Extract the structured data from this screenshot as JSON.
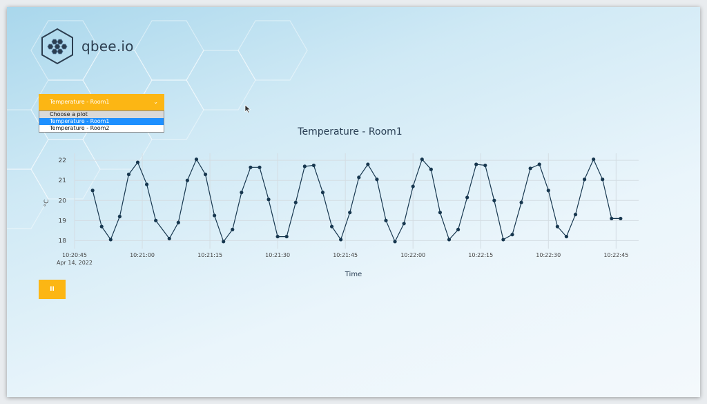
{
  "logo": {
    "text": "qbee.io"
  },
  "plot_select": {
    "selected": "Temperature - Room1",
    "chevron_icon": "chevron-down-icon",
    "options": [
      "Choose a plot",
      "Temperature - Room1",
      "Temperature - Room2"
    ]
  },
  "pause_button": {
    "label": "II",
    "icon": "pause-icon"
  },
  "colors": {
    "accent": "#fcb614",
    "line": "#17374f",
    "selected_option": "#1e90ff"
  },
  "chart_data": {
    "type": "line",
    "title": "Temperature - Room1",
    "xlabel": "Time",
    "ylabel": "°C",
    "ylim": [
      17.6,
      22.35
    ],
    "yticks": [
      18,
      19,
      20,
      21,
      22
    ],
    "xlim_seconds_after_10_20_45": [
      0,
      125
    ],
    "xticks": [
      {
        "label": "10:20:45",
        "sublabel": "Apr 14, 2022",
        "t": 0
      },
      {
        "label": "10:21:00",
        "sublabel": "",
        "t": 15
      },
      {
        "label": "10:21:15",
        "sublabel": "",
        "t": 30
      },
      {
        "label": "10:21:30",
        "sublabel": "",
        "t": 45
      },
      {
        "label": "10:21:45",
        "sublabel": "",
        "t": 60
      },
      {
        "label": "10:22:00",
        "sublabel": "",
        "t": 75
      },
      {
        "label": "10:22:15",
        "sublabel": "",
        "t": 90
      },
      {
        "label": "10:22:30",
        "sublabel": "",
        "t": 105
      },
      {
        "label": "10:22:45",
        "sublabel": "",
        "t": 120
      }
    ],
    "grid": true,
    "series": [
      {
        "name": "",
        "t": [
          4,
          6,
          8,
          10,
          12,
          14,
          16,
          18,
          21,
          23,
          25,
          27,
          29,
          31,
          33,
          35,
          37,
          39,
          41,
          43,
          45,
          47,
          49,
          51,
          53,
          55,
          57,
          59,
          61,
          63,
          65,
          67,
          69,
          71,
          73,
          75,
          77,
          79,
          81,
          83,
          85,
          87,
          89,
          91,
          93,
          95,
          97,
          99,
          101,
          103,
          105,
          107,
          109,
          111,
          113,
          115,
          117,
          119,
          121
        ],
        "values": [
          20.5,
          18.7,
          18.05,
          19.2,
          21.3,
          21.9,
          20.8,
          19.0,
          18.1,
          18.9,
          21.0,
          22.05,
          21.3,
          19.25,
          17.95,
          18.55,
          20.4,
          21.65,
          21.65,
          20.05,
          18.2,
          18.2,
          19.9,
          21.7,
          21.75,
          20.4,
          18.7,
          18.05,
          19.4,
          21.15,
          21.8,
          21.05,
          19.0,
          17.95,
          18.85,
          20.7,
          22.05,
          21.55,
          19.4,
          18.05,
          18.55,
          20.15,
          21.8,
          21.75,
          20.0,
          18.05,
          18.3,
          19.9,
          21.6,
          21.8,
          20.5,
          18.7,
          18.2,
          19.3,
          21.05,
          22.05,
          21.05,
          19.1,
          19.1
        ]
      }
    ]
  }
}
